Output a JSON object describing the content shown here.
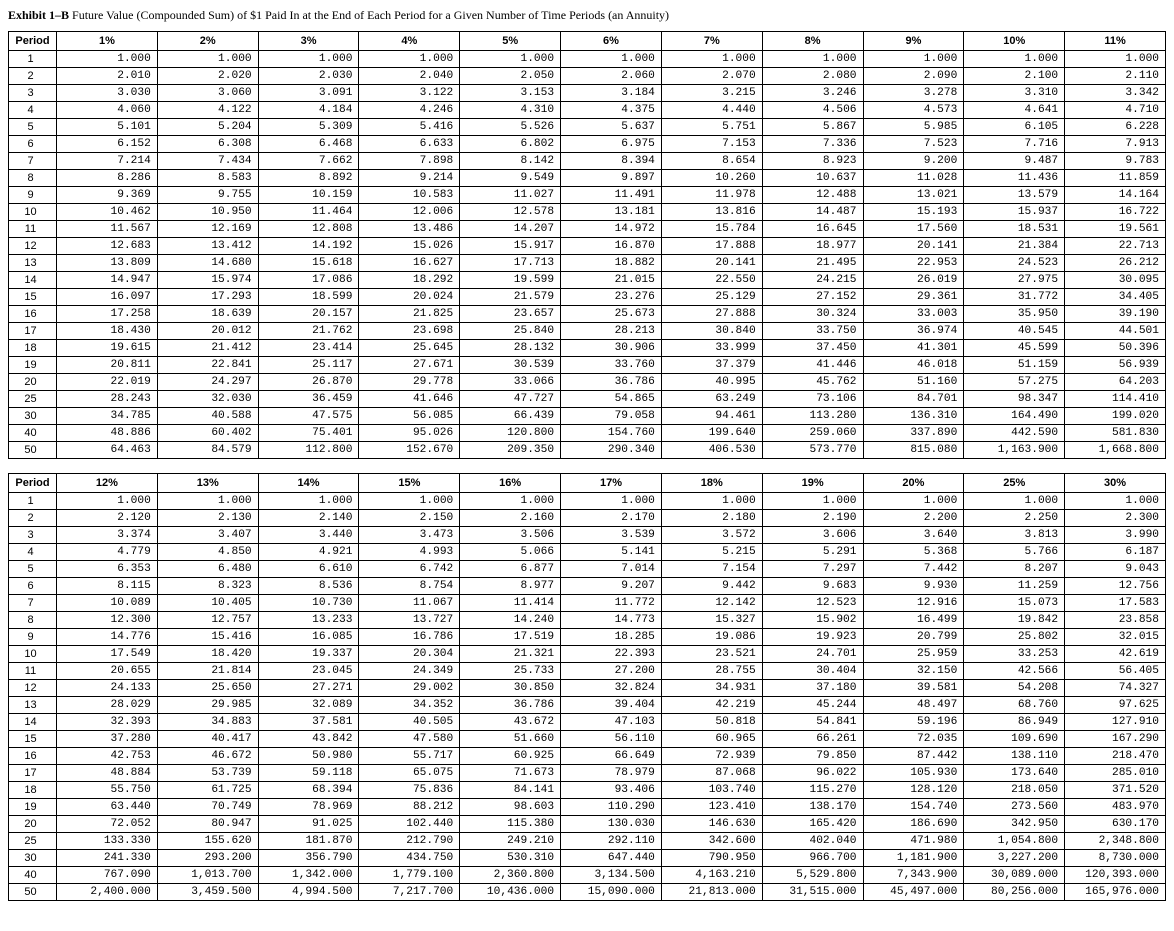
{
  "title_prefix": "Exhibit 1–B",
  "title_rest": " Future Value (Compounded Sum) of $1 Paid In at the End of Each Period for a Given Number of Time Periods (an Annuity)",
  "period_header": "Period",
  "tables": [
    {
      "rates": [
        "1%",
        "2%",
        "3%",
        "4%",
        "5%",
        "6%",
        "7%",
        "8%",
        "9%",
        "10%",
        "11%"
      ],
      "periods": [
        1,
        2,
        3,
        4,
        5,
        6,
        7,
        8,
        9,
        10,
        11,
        12,
        13,
        14,
        15,
        16,
        17,
        18,
        19,
        20,
        25,
        30,
        40,
        50
      ],
      "values": [
        [
          "1.000",
          "1.000",
          "1.000",
          "1.000",
          "1.000",
          "1.000",
          "1.000",
          "1.000",
          "1.000",
          "1.000",
          "1.000"
        ],
        [
          "2.010",
          "2.020",
          "2.030",
          "2.040",
          "2.050",
          "2.060",
          "2.070",
          "2.080",
          "2.090",
          "2.100",
          "2.110"
        ],
        [
          "3.030",
          "3.060",
          "3.091",
          "3.122",
          "3.153",
          "3.184",
          "3.215",
          "3.246",
          "3.278",
          "3.310",
          "3.342"
        ],
        [
          "4.060",
          "4.122",
          "4.184",
          "4.246",
          "4.310",
          "4.375",
          "4.440",
          "4.506",
          "4.573",
          "4.641",
          "4.710"
        ],
        [
          "5.101",
          "5.204",
          "5.309",
          "5.416",
          "5.526",
          "5.637",
          "5.751",
          "5.867",
          "5.985",
          "6.105",
          "6.228"
        ],
        [
          "6.152",
          "6.308",
          "6.468",
          "6.633",
          "6.802",
          "6.975",
          "7.153",
          "7.336",
          "7.523",
          "7.716",
          "7.913"
        ],
        [
          "7.214",
          "7.434",
          "7.662",
          "7.898",
          "8.142",
          "8.394",
          "8.654",
          "8.923",
          "9.200",
          "9.487",
          "9.783"
        ],
        [
          "8.286",
          "8.583",
          "8.892",
          "9.214",
          "9.549",
          "9.897",
          "10.260",
          "10.637",
          "11.028",
          "11.436",
          "11.859"
        ],
        [
          "9.369",
          "9.755",
          "10.159",
          "10.583",
          "11.027",
          "11.491",
          "11.978",
          "12.488",
          "13.021",
          "13.579",
          "14.164"
        ],
        [
          "10.462",
          "10.950",
          "11.464",
          "12.006",
          "12.578",
          "13.181",
          "13.816",
          "14.487",
          "15.193",
          "15.937",
          "16.722"
        ],
        [
          "11.567",
          "12.169",
          "12.808",
          "13.486",
          "14.207",
          "14.972",
          "15.784",
          "16.645",
          "17.560",
          "18.531",
          "19.561"
        ],
        [
          "12.683",
          "13.412",
          "14.192",
          "15.026",
          "15.917",
          "16.870",
          "17.888",
          "18.977",
          "20.141",
          "21.384",
          "22.713"
        ],
        [
          "13.809",
          "14.680",
          "15.618",
          "16.627",
          "17.713",
          "18.882",
          "20.141",
          "21.495",
          "22.953",
          "24.523",
          "26.212"
        ],
        [
          "14.947",
          "15.974",
          "17.086",
          "18.292",
          "19.599",
          "21.015",
          "22.550",
          "24.215",
          "26.019",
          "27.975",
          "30.095"
        ],
        [
          "16.097",
          "17.293",
          "18.599",
          "20.024",
          "21.579",
          "23.276",
          "25.129",
          "27.152",
          "29.361",
          "31.772",
          "34.405"
        ],
        [
          "17.258",
          "18.639",
          "20.157",
          "21.825",
          "23.657",
          "25.673",
          "27.888",
          "30.324",
          "33.003",
          "35.950",
          "39.190"
        ],
        [
          "18.430",
          "20.012",
          "21.762",
          "23.698",
          "25.840",
          "28.213",
          "30.840",
          "33.750",
          "36.974",
          "40.545",
          "44.501"
        ],
        [
          "19.615",
          "21.412",
          "23.414",
          "25.645",
          "28.132",
          "30.906",
          "33.999",
          "37.450",
          "41.301",
          "45.599",
          "50.396"
        ],
        [
          "20.811",
          "22.841",
          "25.117",
          "27.671",
          "30.539",
          "33.760",
          "37.379",
          "41.446",
          "46.018",
          "51.159",
          "56.939"
        ],
        [
          "22.019",
          "24.297",
          "26.870",
          "29.778",
          "33.066",
          "36.786",
          "40.995",
          "45.762",
          "51.160",
          "57.275",
          "64.203"
        ],
        [
          "28.243",
          "32.030",
          "36.459",
          "41.646",
          "47.727",
          "54.865",
          "63.249",
          "73.106",
          "84.701",
          "98.347",
          "114.410"
        ],
        [
          "34.785",
          "40.588",
          "47.575",
          "56.085",
          "66.439",
          "79.058",
          "94.461",
          "113.280",
          "136.310",
          "164.490",
          "199.020"
        ],
        [
          "48.886",
          "60.402",
          "75.401",
          "95.026",
          "120.800",
          "154.760",
          "199.640",
          "259.060",
          "337.890",
          "442.590",
          "581.830"
        ],
        [
          "64.463",
          "84.579",
          "112.800",
          "152.670",
          "209.350",
          "290.340",
          "406.530",
          "573.770",
          "815.080",
          "1,163.900",
          "1,668.800"
        ]
      ]
    },
    {
      "rates": [
        "12%",
        "13%",
        "14%",
        "15%",
        "16%",
        "17%",
        "18%",
        "19%",
        "20%",
        "25%",
        "30%"
      ],
      "periods": [
        1,
        2,
        3,
        4,
        5,
        6,
        7,
        8,
        9,
        10,
        11,
        12,
        13,
        14,
        15,
        16,
        17,
        18,
        19,
        20,
        25,
        30,
        40,
        50
      ],
      "values": [
        [
          "1.000",
          "1.000",
          "1.000",
          "1.000",
          "1.000",
          "1.000",
          "1.000",
          "1.000",
          "1.000",
          "1.000",
          "1.000"
        ],
        [
          "2.120",
          "2.130",
          "2.140",
          "2.150",
          "2.160",
          "2.170",
          "2.180",
          "2.190",
          "2.200",
          "2.250",
          "2.300"
        ],
        [
          "3.374",
          "3.407",
          "3.440",
          "3.473",
          "3.506",
          "3.539",
          "3.572",
          "3.606",
          "3.640",
          "3.813",
          "3.990"
        ],
        [
          "4.779",
          "4.850",
          "4.921",
          "4.993",
          "5.066",
          "5.141",
          "5.215",
          "5.291",
          "5.368",
          "5.766",
          "6.187"
        ],
        [
          "6.353",
          "6.480",
          "6.610",
          "6.742",
          "6.877",
          "7.014",
          "7.154",
          "7.297",
          "7.442",
          "8.207",
          "9.043"
        ],
        [
          "8.115",
          "8.323",
          "8.536",
          "8.754",
          "8.977",
          "9.207",
          "9.442",
          "9.683",
          "9.930",
          "11.259",
          "12.756"
        ],
        [
          "10.089",
          "10.405",
          "10.730",
          "11.067",
          "11.414",
          "11.772",
          "12.142",
          "12.523",
          "12.916",
          "15.073",
          "17.583"
        ],
        [
          "12.300",
          "12.757",
          "13.233",
          "13.727",
          "14.240",
          "14.773",
          "15.327",
          "15.902",
          "16.499",
          "19.842",
          "23.858"
        ],
        [
          "14.776",
          "15.416",
          "16.085",
          "16.786",
          "17.519",
          "18.285",
          "19.086",
          "19.923",
          "20.799",
          "25.802",
          "32.015"
        ],
        [
          "17.549",
          "18.420",
          "19.337",
          "20.304",
          "21.321",
          "22.393",
          "23.521",
          "24.701",
          "25.959",
          "33.253",
          "42.619"
        ],
        [
          "20.655",
          "21.814",
          "23.045",
          "24.349",
          "25.733",
          "27.200",
          "28.755",
          "30.404",
          "32.150",
          "42.566",
          "56.405"
        ],
        [
          "24.133",
          "25.650",
          "27.271",
          "29.002",
          "30.850",
          "32.824",
          "34.931",
          "37.180",
          "39.581",
          "54.208",
          "74.327"
        ],
        [
          "28.029",
          "29.985",
          "32.089",
          "34.352",
          "36.786",
          "39.404",
          "42.219",
          "45.244",
          "48.497",
          "68.760",
          "97.625"
        ],
        [
          "32.393",
          "34.883",
          "37.581",
          "40.505",
          "43.672",
          "47.103",
          "50.818",
          "54.841",
          "59.196",
          "86.949",
          "127.910"
        ],
        [
          "37.280",
          "40.417",
          "43.842",
          "47.580",
          "51.660",
          "56.110",
          "60.965",
          "66.261",
          "72.035",
          "109.690",
          "167.290"
        ],
        [
          "42.753",
          "46.672",
          "50.980",
          "55.717",
          "60.925",
          "66.649",
          "72.939",
          "79.850",
          "87.442",
          "138.110",
          "218.470"
        ],
        [
          "48.884",
          "53.739",
          "59.118",
          "65.075",
          "71.673",
          "78.979",
          "87.068",
          "96.022",
          "105.930",
          "173.640",
          "285.010"
        ],
        [
          "55.750",
          "61.725",
          "68.394",
          "75.836",
          "84.141",
          "93.406",
          "103.740",
          "115.270",
          "128.120",
          "218.050",
          "371.520"
        ],
        [
          "63.440",
          "70.749",
          "78.969",
          "88.212",
          "98.603",
          "110.290",
          "123.410",
          "138.170",
          "154.740",
          "273.560",
          "483.970"
        ],
        [
          "72.052",
          "80.947",
          "91.025",
          "102.440",
          "115.380",
          "130.030",
          "146.630",
          "165.420",
          "186.690",
          "342.950",
          "630.170"
        ],
        [
          "133.330",
          "155.620",
          "181.870",
          "212.790",
          "249.210",
          "292.110",
          "342.600",
          "402.040",
          "471.980",
          "1,054.800",
          "2,348.800"
        ],
        [
          "241.330",
          "293.200",
          "356.790",
          "434.750",
          "530.310",
          "647.440",
          "790.950",
          "966.700",
          "1,181.900",
          "3,227.200",
          "8,730.000"
        ],
        [
          "767.090",
          "1,013.700",
          "1,342.000",
          "1,779.100",
          "2,360.800",
          "3,134.500",
          "4,163.210",
          "5,529.800",
          "7,343.900",
          "30,089.000",
          "120,393.000"
        ],
        [
          "2,400.000",
          "3,459.500",
          "4,994.500",
          "7,217.700",
          "10,436.000",
          "15,090.000",
          "21,813.000",
          "31,515.000",
          "45,497.000",
          "80,256.000",
          "165,976.000"
        ]
      ]
    }
  ]
}
